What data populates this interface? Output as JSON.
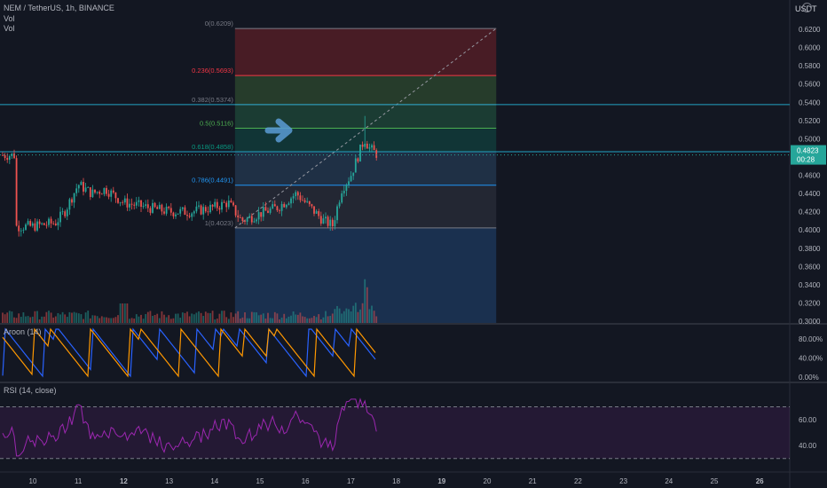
{
  "header": {
    "symbol_line": "NEM / TetherUS, 1h, BINANCE",
    "vol_label_1": "Vol",
    "vol_label_2": "Vol"
  },
  "price_axis": {
    "unit": "USDT",
    "ticks": [
      "0.6200",
      "0.6000",
      "0.5800",
      "0.5600",
      "0.5400",
      "0.5200",
      "0.5000",
      "0.4800",
      "0.4600",
      "0.4400",
      "0.4200",
      "0.4000",
      "0.3800",
      "0.3600",
      "0.3400",
      "0.3200",
      "0.3000"
    ],
    "current_price": "0.4823",
    "current_countdown": "00:28",
    "current_color": "#26a69a"
  },
  "time_axis": {
    "labels": [
      "10",
      "11",
      "12",
      "13",
      "14",
      "15",
      "16",
      "17",
      "18",
      "19",
      "20",
      "21",
      "22",
      "23",
      "24",
      "25",
      "26"
    ],
    "bold_labels": [
      "12",
      "19",
      "26"
    ]
  },
  "aroon_pane": {
    "label": "Aroon (14)",
    "ticks": [
      "80.00%",
      "40.00%",
      "0.00%"
    ],
    "up_color": "#ff9800",
    "down_color": "#2962ff"
  },
  "rsi_pane": {
    "label": "RSI (14, close)",
    "ticks": [
      "60.00",
      "40.00"
    ],
    "line_color": "#9c27b0",
    "band_upper": 70,
    "band_lower": 30
  },
  "fib_levels": [
    {
      "label": "0(0.6209)",
      "ratio": "0",
      "price": 0.6209,
      "color": "#787b86"
    },
    {
      "label": "0.236(0.5693)",
      "ratio": "0.236",
      "price": 0.5693,
      "color": "#f23645"
    },
    {
      "label": "0.382(0.5374)",
      "ratio": "0.382",
      "price": 0.5374,
      "color": "#787b86"
    },
    {
      "label": "0.5(0.5116)",
      "ratio": "0.5",
      "price": 0.5116,
      "color": "#4caf50"
    },
    {
      "label": "0.618(0.4858)",
      "ratio": "0.618",
      "price": 0.4858,
      "color": "#089981"
    },
    {
      "label": "0.786(0.4491)",
      "ratio": "0.786",
      "price": 0.4491,
      "color": "#2196f3"
    },
    {
      "label": "1(0.4023)",
      "ratio": "1",
      "price": 0.4023,
      "color": "#787b86"
    }
  ],
  "horizontal_lines": [
    0.5374,
    0.4858
  ],
  "chart_data": {
    "type": "candlestick",
    "symbol": "NEM / TetherUS",
    "interval": "1h",
    "exchange": "BINANCE",
    "ylim": [
      0.3,
      0.625
    ],
    "price_line": 0.4823,
    "ohlc_keypoints": [
      {
        "t": "9.6",
        "price": 0.404
      },
      {
        "t": "10.0",
        "price": 0.404
      },
      {
        "t": "10.5",
        "price": 0.408
      },
      {
        "t": "10.7",
        "price": 0.42
      },
      {
        "t": "11.0",
        "price": 0.45
      },
      {
        "t": "11.3",
        "price": 0.44
      },
      {
        "t": "11.6",
        "price": 0.445
      },
      {
        "t": "12.0",
        "price": 0.43
      },
      {
        "t": "12.5",
        "price": 0.425
      },
      {
        "t": "13.0",
        "price": 0.42
      },
      {
        "t": "13.5",
        "price": 0.42
      },
      {
        "t": "14.0",
        "price": 0.425
      },
      {
        "t": "14.3",
        "price": 0.43
      },
      {
        "t": "14.6",
        "price": 0.41
      },
      {
        "t": "15.0",
        "price": 0.418
      },
      {
        "t": "15.4",
        "price": 0.425
      },
      {
        "t": "15.8",
        "price": 0.44
      },
      {
        "t": "16.0",
        "price": 0.43
      },
      {
        "t": "16.4",
        "price": 0.41
      },
      {
        "t": "16.6",
        "price": 0.405
      },
      {
        "t": "16.8",
        "price": 0.445
      },
      {
        "t": "17.0",
        "price": 0.46
      },
      {
        "t": "17.3",
        "price": 0.5
      },
      {
        "t": "17.4",
        "price": 0.49
      },
      {
        "t": "17.6",
        "price": 0.482
      }
    ]
  }
}
